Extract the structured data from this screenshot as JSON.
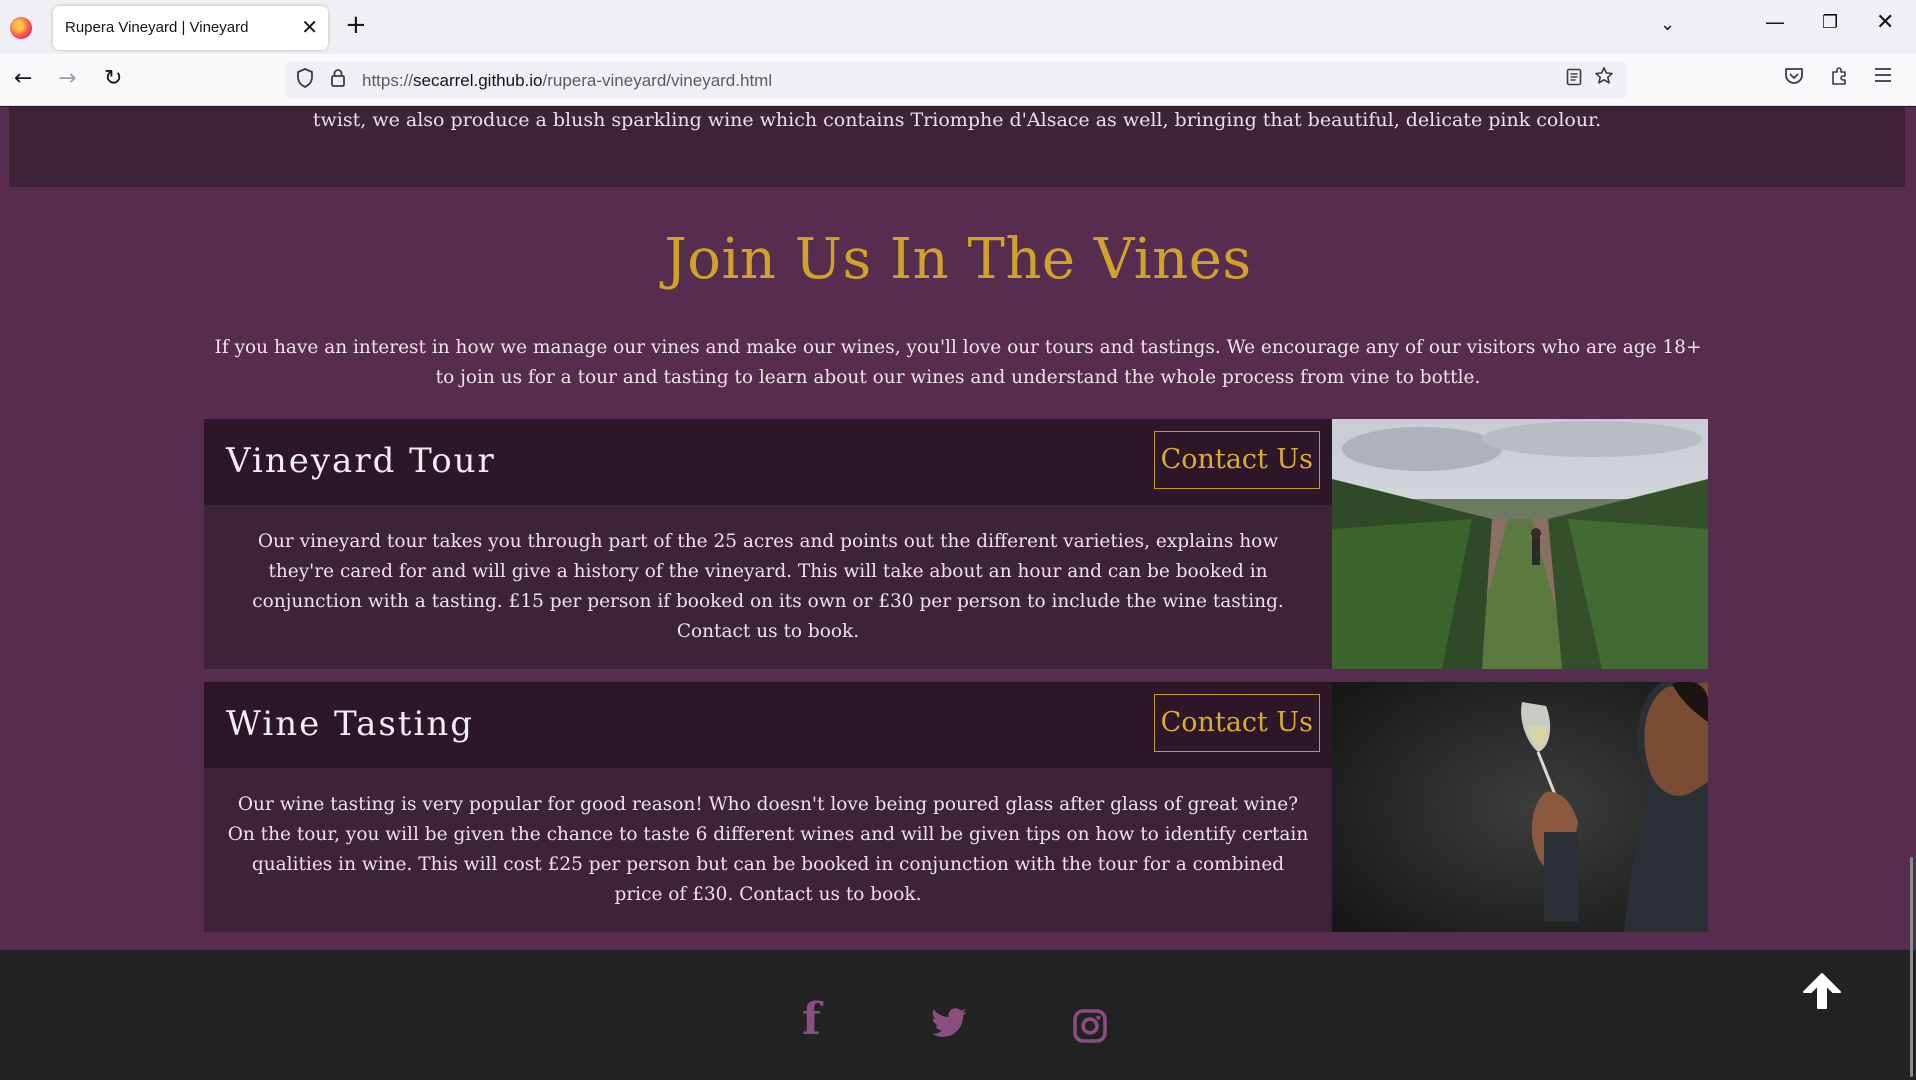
{
  "browser": {
    "tab_title": "Rupera Vineyard | Vineyard",
    "tab_close": "✕",
    "new_tab": "+",
    "list_tabs": "⌄",
    "win_min": "—",
    "win_max": "❐",
    "win_close": "✕",
    "back": "←",
    "forward": "→",
    "reload": "↻",
    "url_scheme": "https://",
    "url_host": "secarrel.github.io",
    "url_path": "/rupera-vineyard/vineyard.html",
    "icons": [
      "firefox-logo-icon",
      "shield-icon",
      "lock-icon",
      "reader-view-icon",
      "bookmark-star-icon",
      "pocket-icon",
      "extensions-icon",
      "menu-icon"
    ]
  },
  "page": {
    "top_text": "twist, we also produce a blush sparkling wine which contains Triomphe d'Alsace as well, bringing that beautiful, delicate pink colour.",
    "section_title": "Join Us In The Vines",
    "intro": "If you have an interest in how we manage our vines and make our wines, you'll love our tours and tastings. We encourage any of our visitors who are age 18+ to join us for a tour and tasting to learn about our wines and understand the whole process from vine to bottle.",
    "cards": [
      {
        "title": "Vineyard Tour",
        "button": "Contact Us",
        "text": "Our vineyard tour takes you through part of the 25 acres and points out the different varieties, explains how they're cared for and will give a history of the vineyard. This will take about an hour and can be booked in conjunction with a tasting. £15 per person if booked on its own or £30 per person to include the wine tasting. Contact us to book."
      },
      {
        "title": "Wine Tasting",
        "button": "Contact Us",
        "text": "Our wine tasting is very popular for good reason! Who doesn't love being poured glass after glass of great wine? On the tour, you will be given the chance to taste 6 different wines and will be given tips on how to identify certain qualities in wine. This will cost £25 per person but can be booked in conjunction with the tour for a combined price of £30. Contact us to book."
      }
    ],
    "footer": {
      "facebook": "f",
      "social_icons": [
        "facebook-icon",
        "twitter-icon",
        "instagram-icon"
      ],
      "back_to_top_icon": "arrow-up-icon"
    },
    "colors": {
      "background": "#572d4f",
      "card": "#3e2238",
      "card_header": "#2c1627",
      "gold": "#d0a22b",
      "footer": "#222222",
      "social": "#8a4f80"
    }
  }
}
